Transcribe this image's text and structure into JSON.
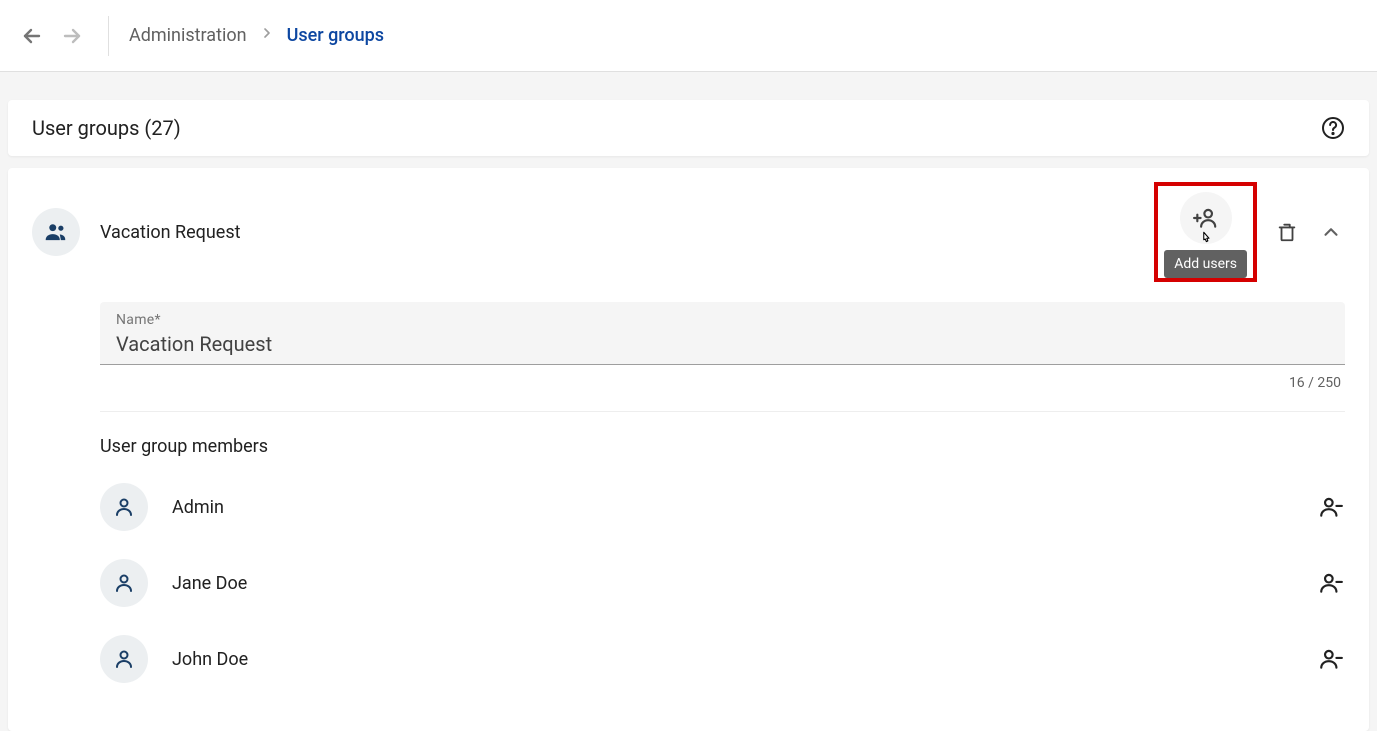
{
  "breadcrumb": {
    "parent": "Administration",
    "current": "User groups"
  },
  "panel": {
    "title": "User groups (27)"
  },
  "group": {
    "name": "Vacation Request",
    "name_field_label": "Name*",
    "name_field_value": "Vacation Request",
    "char_count": "16 / 250",
    "add_users_tooltip": "Add users",
    "members_heading": "User group members",
    "members": [
      {
        "name": "Admin"
      },
      {
        "name": "Jane Doe"
      },
      {
        "name": "John Doe"
      }
    ]
  }
}
